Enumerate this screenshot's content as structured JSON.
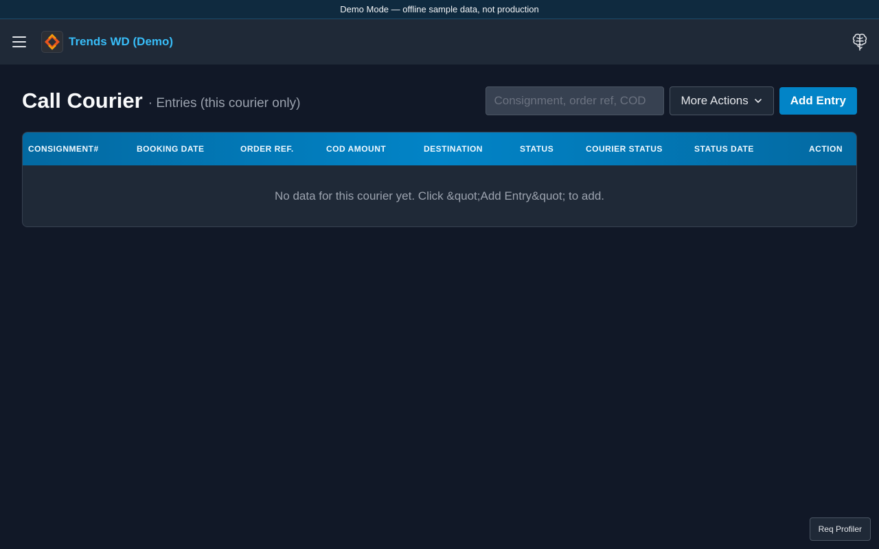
{
  "banner": {
    "text": "Demo Mode — offline sample data, not production"
  },
  "header": {
    "app_title": "Trends WD (Demo)"
  },
  "page": {
    "title": "Call Courier",
    "subtitle": "· Entries (this courier only)"
  },
  "toolbar": {
    "search_placeholder": "Consignment, order ref, COD",
    "search_value": "",
    "more_actions_label": "More Actions",
    "add_entry_label": "Add Entry"
  },
  "table": {
    "columns": [
      "CONSIGNMENT#",
      "BOOKING DATE",
      "ORDER REF.",
      "COD AMOUNT",
      "DESTINATION",
      "STATUS",
      "COURIER STATUS",
      "STATUS DATE",
      "ACTION"
    ],
    "empty_message": "No data for this courier yet. Click &quot;Add Entry&quot; to add."
  },
  "footer": {
    "profiler_label": "Req Profiler"
  },
  "colors": {
    "accent": "#0284c7",
    "title_accent": "#38bdf8",
    "background": "#111827",
    "surface": "#1f2937"
  },
  "icons": {
    "menu": "hamburger-menu-icon",
    "logo": "app-logo-icon",
    "brain": "brain-icon",
    "dropdown": "chevron-down-icon"
  }
}
